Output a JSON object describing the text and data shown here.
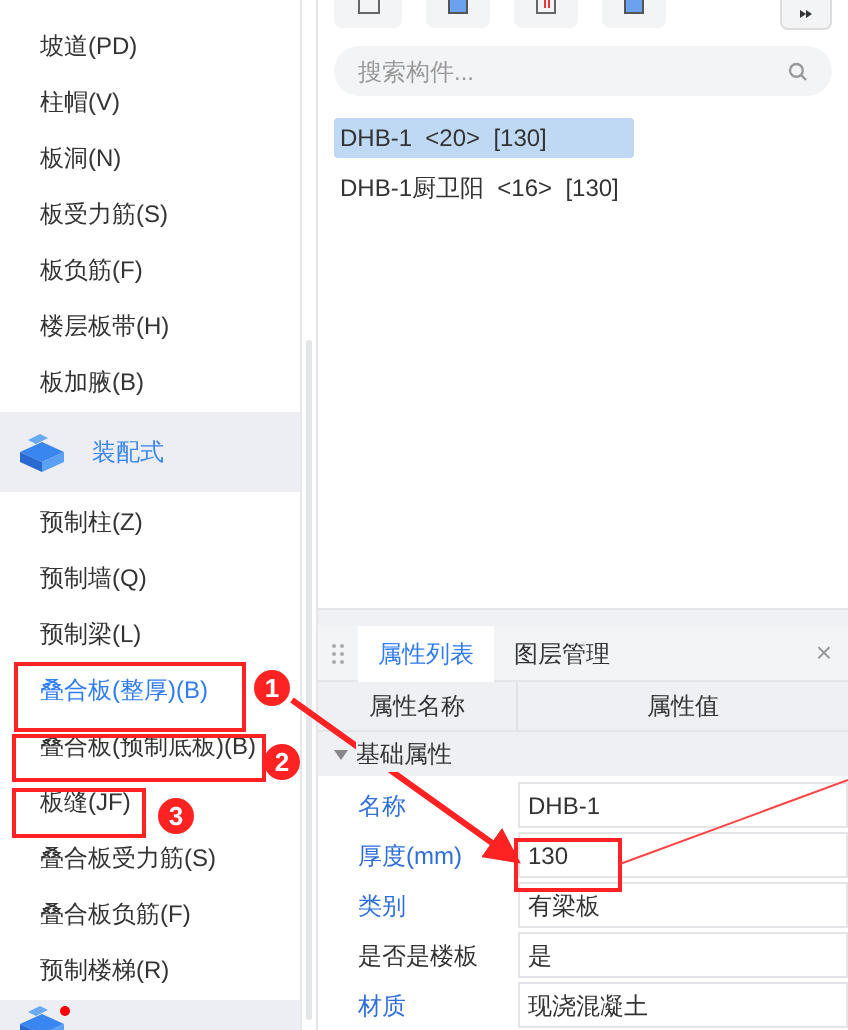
{
  "sidebar": {
    "items": [
      {
        "kind": "item",
        "label": "坡道(PD)",
        "selected": false
      },
      {
        "kind": "item",
        "label": "柱帽(V)",
        "selected": false
      },
      {
        "kind": "item",
        "label": "板洞(N)",
        "selected": false
      },
      {
        "kind": "item",
        "label": "板受力筋(S)",
        "selected": false
      },
      {
        "kind": "item",
        "label": "板负筋(F)",
        "selected": false
      },
      {
        "kind": "item",
        "label": "楼层板带(H)",
        "selected": false
      },
      {
        "kind": "item",
        "label": "板加腋(B)",
        "selected": false
      },
      {
        "kind": "category",
        "label": "装配式",
        "notification": false
      },
      {
        "kind": "item",
        "label": "预制柱(Z)",
        "selected": false
      },
      {
        "kind": "item",
        "label": "预制墙(Q)",
        "selected": false
      },
      {
        "kind": "item",
        "label": "预制梁(L)",
        "selected": false
      },
      {
        "kind": "item",
        "label": "叠合板(整厚)(B)",
        "selected": true
      },
      {
        "kind": "item",
        "label": "叠合板(预制底板)(B)",
        "selected": false
      },
      {
        "kind": "item",
        "label": "板缝(JF)",
        "selected": false
      },
      {
        "kind": "item",
        "label": "叠合板受力筋(S)",
        "selected": false
      },
      {
        "kind": "item",
        "label": "叠合板负筋(F)",
        "selected": false
      },
      {
        "kind": "item",
        "label": "预制楼梯(R)",
        "selected": false
      },
      {
        "kind": "category",
        "notification": true
      }
    ]
  },
  "component_list": {
    "search": {
      "placeholder": "搜索构件..."
    },
    "items": [
      {
        "label": "DHB-1  <20>  [130]",
        "selected": true
      },
      {
        "label": "DHB-1厨卫阳  <16>  [130]",
        "selected": false
      }
    ]
  },
  "properties": {
    "tabs": [
      {
        "label": "属性列表",
        "selected": true
      },
      {
        "label": "图层管理",
        "selected": false
      }
    ],
    "close": "×",
    "columns": [
      "属性名称",
      "属性值"
    ],
    "group": {
      "label": "基础属性",
      "expanded": true
    },
    "rows": [
      {
        "name": "名称",
        "value": "DHB-1",
        "highlighted": true
      },
      {
        "name": "厚度(mm)",
        "value": "130",
        "highlighted": true
      },
      {
        "name": "类别",
        "value": "有梁板",
        "highlighted": true
      },
      {
        "name": "是否是楼板",
        "value": "是",
        "highlighted": false
      },
      {
        "name": "材质",
        "value": "现浇混凝土",
        "highlighted": true
      }
    ]
  },
  "annotations": [
    {
      "number": "1"
    },
    {
      "number": "2"
    },
    {
      "number": "3"
    }
  ]
}
